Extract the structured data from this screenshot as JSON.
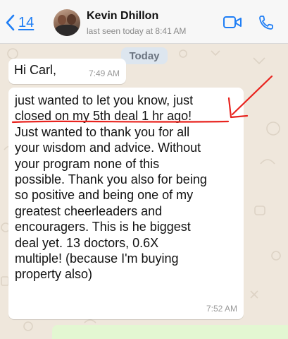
{
  "header": {
    "back_count": "14",
    "contact_name": "Kevin Dhillon",
    "last_seen": "last seen today at 8:41 AM"
  },
  "chat": {
    "date_label": "Today",
    "messages": [
      {
        "text": "Hi Carl,",
        "time": "7:49 AM"
      },
      {
        "text": "just wanted to let you know, just\nclosed on my 5th deal 1 hr ago!\nJust wanted to thank you for all\nyour wisdom and advice. Without\nyour program none of this\npossible. Thank you also for being\nso positive and being one of my\ngreatest cheerleaders and\nencouragers. This is he biggest\ndeal yet. 13 doctors, 0.6X\nmultiple! (because I'm buying\nproperty also)",
        "time": "7:52 AM"
      }
    ]
  },
  "colors": {
    "accent": "#1f7ef5",
    "annotation": "#e8231e",
    "wallpaper": "#efe7dc",
    "outgoing_bubble": "#e3f7d2"
  },
  "icons": [
    "back-chevron-icon",
    "video-camera-icon",
    "phone-icon"
  ]
}
